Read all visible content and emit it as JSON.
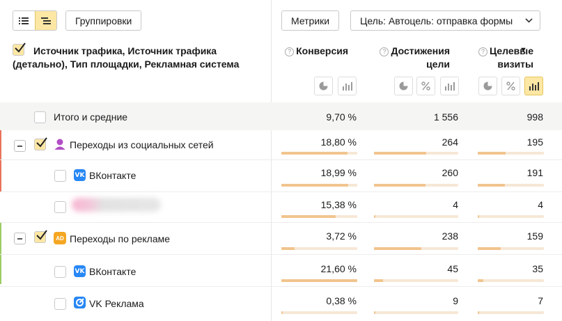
{
  "toolbar": {
    "groupings_label": "Группировки",
    "metrics_label": "Метрики",
    "goal_select": "Цель: Автоцель: отправка формы"
  },
  "header": {
    "dimensions_title": "Источник трафика, Источник трафика (детально), Тип площадки, Рекламная система",
    "metric_conversion": "Конверсия",
    "metric_goal_reaches": "Достижения цели",
    "metric_target_visits": "Целевые визиты",
    "sort_indicator": "▼",
    "help_mark": "?"
  },
  "rows": [
    {
      "label": "Итого и средние",
      "conversion": "9,70 %",
      "reaches": "1 556",
      "visits": "998",
      "conv_bar": 0,
      "reach_bar": 0,
      "visit_bar": 0
    },
    {
      "label": "Переходы из социальных сетей",
      "conversion": "18,80 %",
      "reaches": "264",
      "visits": "195",
      "conv_bar": 0.87,
      "reach_bar": 0.62,
      "visit_bar": 0.42
    },
    {
      "label": "ВКонтакте",
      "conversion": "18,99 %",
      "reaches": "260",
      "visits": "191",
      "conv_bar": 0.88,
      "reach_bar": 0.61,
      "visit_bar": 0.41
    },
    {
      "label": "",
      "conversion": "15,38 %",
      "reaches": "4",
      "visits": "4",
      "conv_bar": 0.72,
      "reach_bar": 0.02,
      "visit_bar": 0.02
    },
    {
      "label": "Переходы по рекламе",
      "conversion": "3,72 %",
      "reaches": "238",
      "visits": "159",
      "conv_bar": 0.17,
      "reach_bar": 0.56,
      "visit_bar": 0.35
    },
    {
      "label": "ВКонтакте",
      "conversion": "21,60 %",
      "reaches": "45",
      "visits": "35",
      "conv_bar": 1.0,
      "reach_bar": 0.11,
      "visit_bar": 0.08
    },
    {
      "label": "VK Реклама",
      "conversion": "0,38 %",
      "reaches": "9",
      "visits": "7",
      "conv_bar": 0.02,
      "reach_bar": 0.02,
      "visit_bar": 0.02
    }
  ],
  "icons": {
    "vk_text": "VK",
    "ad_text": "AD"
  },
  "colors": {
    "active_button": "#fde7a4",
    "bar_fill": "#f1c48e",
    "bar_track": "#f6e8d6",
    "social_group_marker": "#e8735a",
    "ads_group_marker": "#9ccc65",
    "vk_blue": "#2787f5",
    "ads_orange": "#f5a623"
  }
}
